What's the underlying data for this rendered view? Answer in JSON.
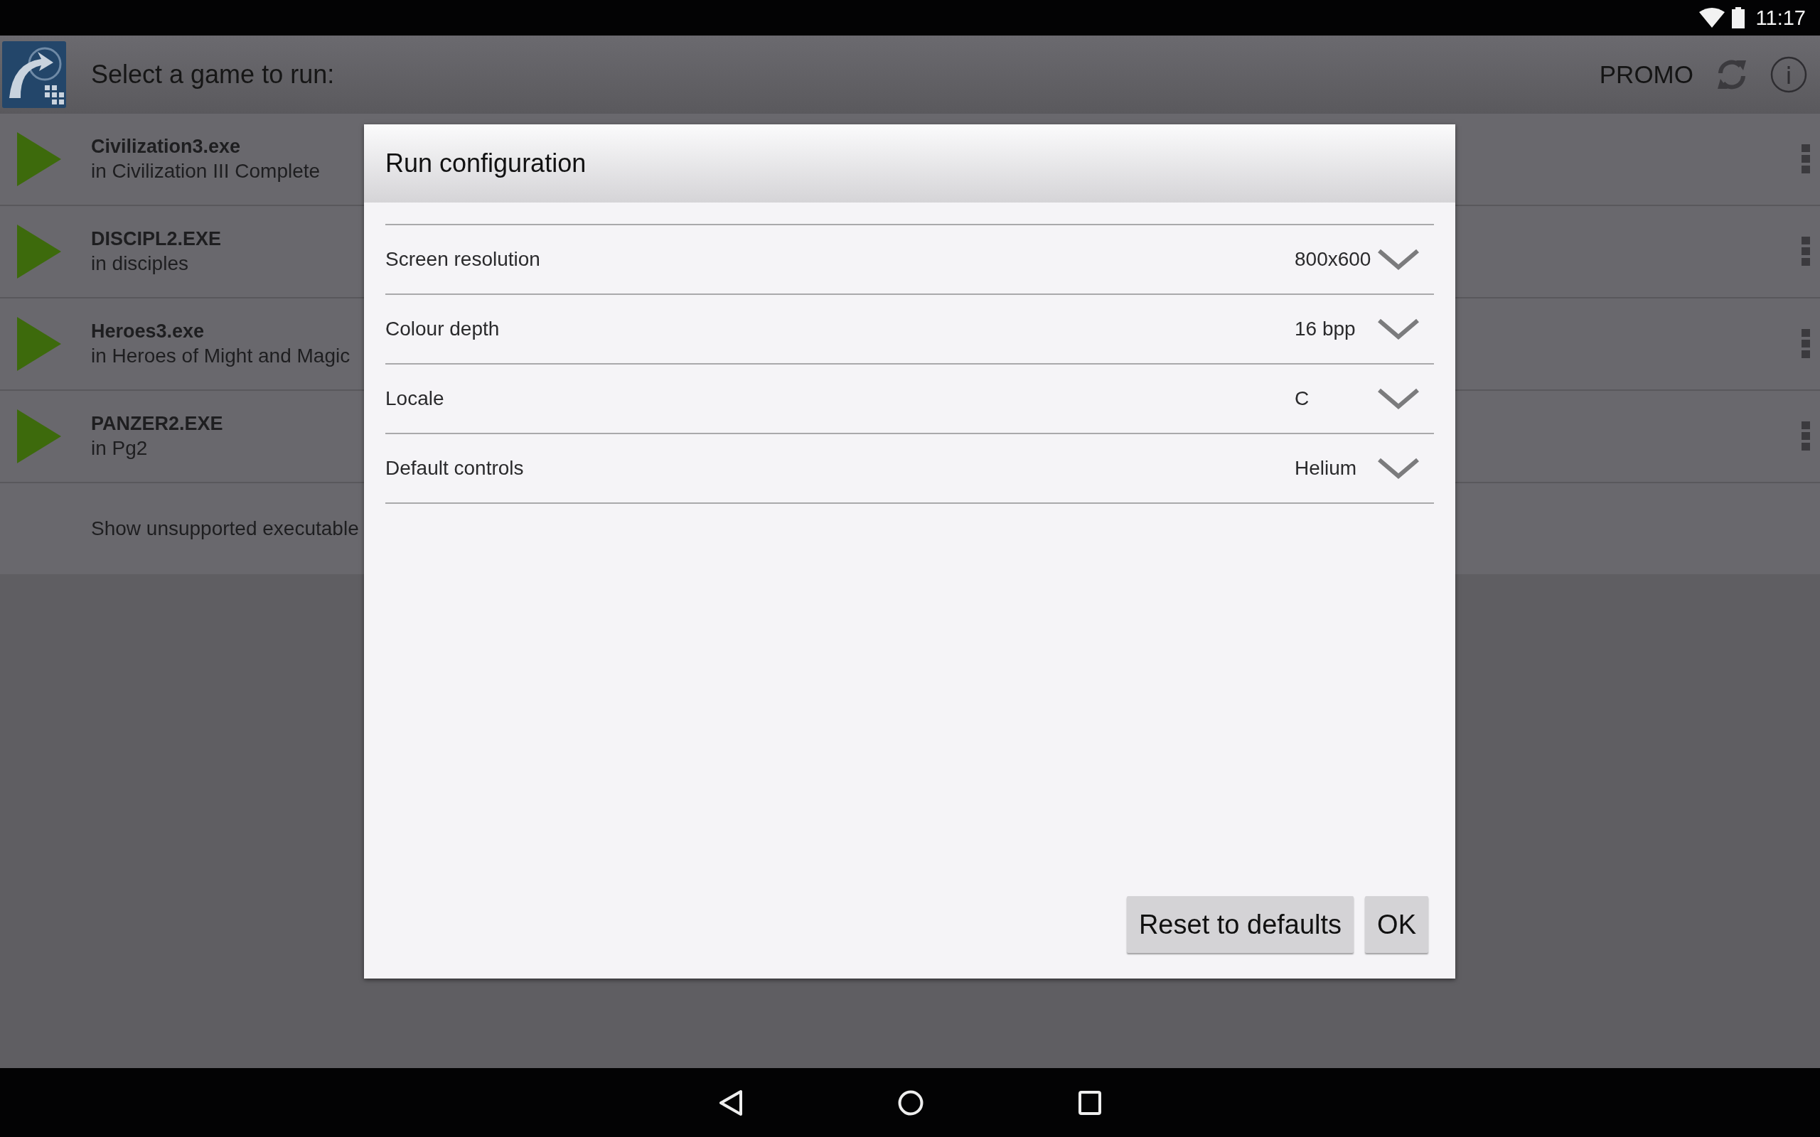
{
  "status_bar": {
    "time": "11:17"
  },
  "app_bar": {
    "title": "Select a game to run:",
    "action": "PROMO"
  },
  "games": [
    {
      "name": "Civilization3.exe",
      "location": "in Civilization III Complete"
    },
    {
      "name": "DISCIPL2.EXE",
      "location": "in disciples"
    },
    {
      "name": "Heroes3.exe",
      "location": "in Heroes of Might and Magic"
    },
    {
      "name": "PANZER2.EXE",
      "location": "in Pg2"
    }
  ],
  "show_unsupported": "Show unsupported executable",
  "dialog": {
    "title": "Run configuration",
    "settings": [
      {
        "label": "Screen resolution",
        "value": "800x600"
      },
      {
        "label": "Colour depth",
        "value": "16 bpp"
      },
      {
        "label": "Locale",
        "value": "C"
      },
      {
        "label": "Default controls",
        "value": "Helium"
      }
    ],
    "buttons": [
      "Reset to defaults",
      "OK"
    ]
  }
}
